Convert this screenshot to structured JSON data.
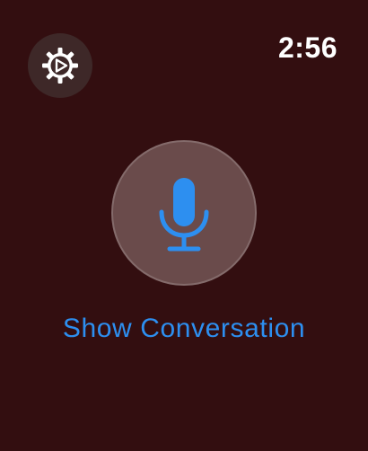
{
  "status": {
    "time": "2:56"
  },
  "settings": {
    "icon": "gear-play-icon",
    "icon_color": "#ffffff"
  },
  "microphone": {
    "icon": "microphone-icon",
    "icon_color": "#2d8ff0"
  },
  "actions": {
    "show_conversation_label": "Show Conversation"
  },
  "colors": {
    "background": "#330e10",
    "accent": "#2d8ff0",
    "settings_button_bg": "#3e2828",
    "mic_button_bg": "#6a4b4b"
  }
}
